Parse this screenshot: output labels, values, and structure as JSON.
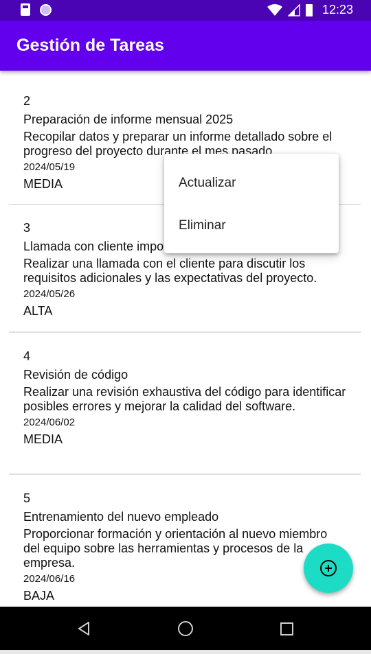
{
  "status_bar": {
    "time": "12:23"
  },
  "app_bar": {
    "title": "Gestión de Tareas"
  },
  "tasks": [
    {
      "id": "2",
      "name": "Preparación de informe mensual 2025",
      "description": "Recopilar datos y preparar un informe detallado sobre el progreso del proyecto durante el mes pasado.",
      "date": "2024/05/19",
      "priority": "MEDIA"
    },
    {
      "id": "3",
      "name": "Llamada con cliente impo",
      "description": "Realizar una llamada con el cliente para discutir los requisitos adicionales y las expectativas del proyecto.",
      "date": "2024/05/26",
      "priority": "ALTA"
    },
    {
      "id": "4",
      "name": "Revisión de código",
      "description": "Realizar una revisión exhaustiva del código para identificar posibles errores y mejorar la calidad del software.",
      "date": "2024/06/02",
      "priority": "MEDIA"
    },
    {
      "id": "5",
      "name": "Entrenamiento del nuevo empleado",
      "description": "Proporcionar formación y orientación al nuevo miembro del equipo sobre las herramientas y procesos de la empresa.",
      "date": "2024/06/16",
      "priority": "BAJA"
    }
  ],
  "context_menu": {
    "items": [
      "Actualizar",
      "Eliminar"
    ]
  },
  "fab": {
    "icon": "add-circle-icon"
  },
  "colors": {
    "status_bar": "#4a04b3",
    "app_bar": "#6200ee",
    "fab": "#1ddcc5"
  }
}
